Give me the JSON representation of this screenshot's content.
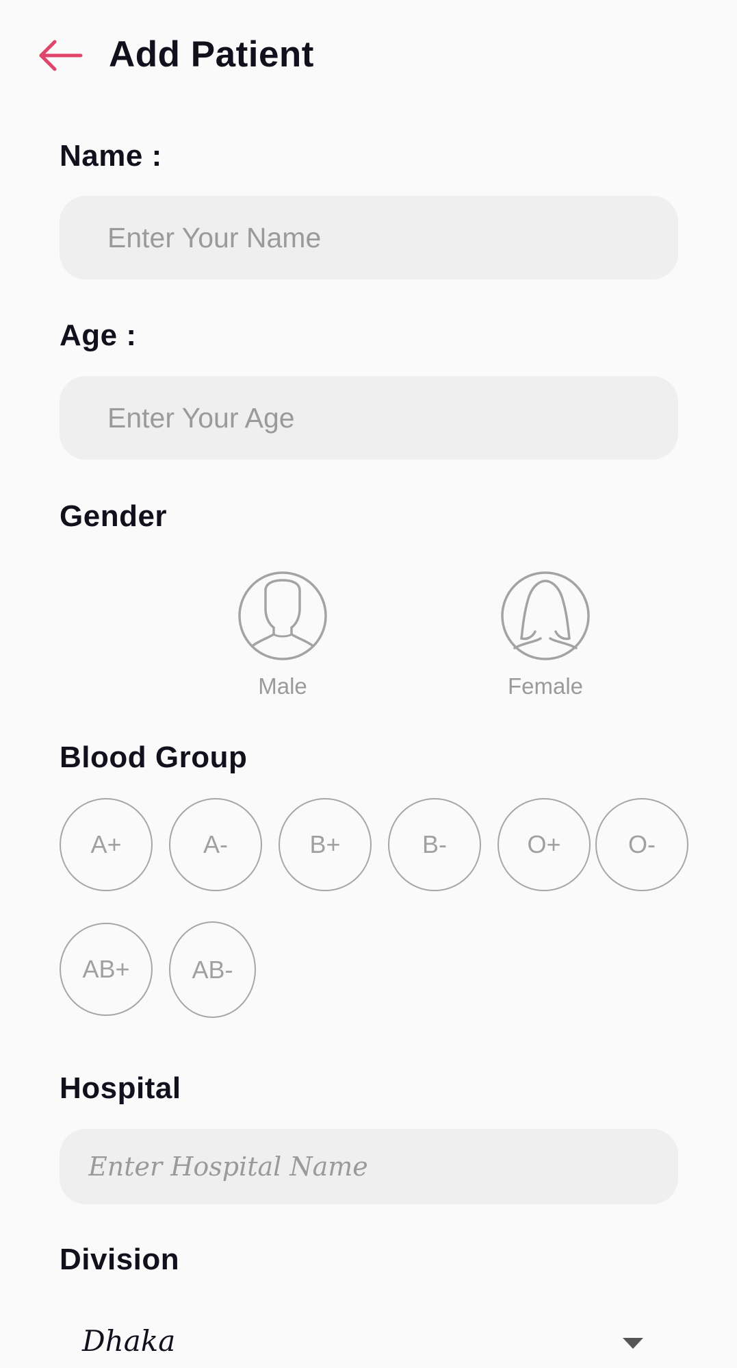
{
  "header": {
    "title": "Add Patient",
    "back_icon": "arrow-left-icon",
    "accent_color": "#e0446a"
  },
  "form": {
    "name": {
      "label": "Name :",
      "placeholder": "Enter Your Name",
      "value": ""
    },
    "age": {
      "label": "Age :",
      "placeholder": "Enter Your Age",
      "value": ""
    },
    "gender": {
      "label": "Gender",
      "options": [
        {
          "label": "Male",
          "icon": "male-avatar-icon"
        },
        {
          "label": "Female",
          "icon": "female-avatar-icon"
        }
      ]
    },
    "blood_group": {
      "label": "Blood Group",
      "options": [
        "A+",
        "A-",
        "B+",
        "B-",
        "O+",
        "O-",
        "AB+",
        "AB-"
      ]
    },
    "hospital": {
      "label": "Hospital",
      "placeholder": "Enter Hospital Name",
      "value": ""
    },
    "division": {
      "label": "Division",
      "selected": "Dhaka",
      "icon": "dropdown-caret-icon"
    }
  }
}
